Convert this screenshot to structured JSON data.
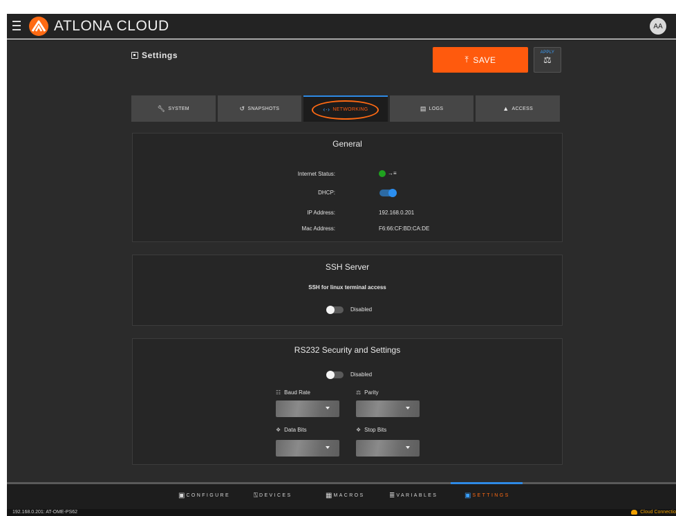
{
  "app": {
    "title": "ATLONA CLOUD",
    "avatar_initials": "AA"
  },
  "header": {
    "page_title": "Settings",
    "save_label": "SAVE",
    "apply_label": "APPLY"
  },
  "tabs": [
    {
      "label": "SYSTEM",
      "icon": "wrench-icon",
      "active": false
    },
    {
      "label": "SNAPSHOTS",
      "icon": "history-icon",
      "active": false
    },
    {
      "label": "NETWORKING",
      "icon": "code-arrows-icon",
      "active": true
    },
    {
      "label": "LOGS",
      "icon": "document-icon",
      "active": false
    },
    {
      "label": "ACCESS",
      "icon": "person-icon",
      "active": false
    }
  ],
  "general": {
    "title": "General",
    "internet_status_label": "Internet Status:",
    "internet_status_connected": true,
    "dhcp_label": "DHCP:",
    "dhcp_enabled": true,
    "ip_label": "IP Address:",
    "ip_value": "192.168.0.201",
    "mac_label": "Mac Address:",
    "mac_value": "F6:66:CF:BD:CA:DE"
  },
  "ssh": {
    "title": "SSH Server",
    "subtitle": "SSH for linux terminal access",
    "enabled": false,
    "status_label": "Disabled"
  },
  "rs232": {
    "title": "RS232 Security and Settings",
    "enabled": false,
    "status_label": "Disabled",
    "baud_rate_label": "Baud Rate",
    "parity_label": "Parity",
    "data_bits_label": "Data Bits",
    "stop_bits_label": "Stop Bits"
  },
  "bottom_nav": [
    {
      "label": "CONFIGURE",
      "icon": "tablet-icon",
      "active": false
    },
    {
      "label": "DEVICES",
      "icon": "devices-icon",
      "active": false
    },
    {
      "label": "MACROS",
      "icon": "grid-icon",
      "active": false
    },
    {
      "label": "VARIABLES",
      "icon": "sliders-icon",
      "active": false
    },
    {
      "label": "SETTINGS",
      "icon": "settings-icon",
      "active": true
    }
  ],
  "status_bar": {
    "device_info": "192.168.0.201: AT-OME-PS62",
    "cloud_status": "Cloud Connectio"
  },
  "colors": {
    "accent_orange": "#ff5a0d",
    "accent_blue": "#2e8ae6",
    "status_green": "#1fa21f",
    "warning_amber": "#f0a000"
  }
}
